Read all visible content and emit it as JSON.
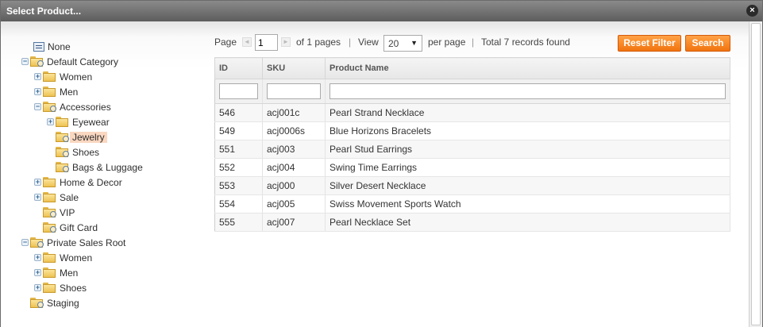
{
  "dialog": {
    "title": "Select Product...",
    "close_glyph": "×"
  },
  "tree": {
    "items": [
      {
        "label": "None",
        "icon": "none-icon"
      },
      {
        "label": "Default Category",
        "toggle": "−"
      },
      {
        "label": "Women",
        "toggle": "+"
      },
      {
        "label": "Men",
        "toggle": "+"
      },
      {
        "label": "Accessories",
        "toggle": "−"
      },
      {
        "label": "Eyewear",
        "toggle": "+"
      },
      {
        "label": "Jewelry",
        "selected": true
      },
      {
        "label": "Shoes"
      },
      {
        "label": "Bags & Luggage"
      },
      {
        "label": "Home & Decor",
        "toggle": "+"
      },
      {
        "label": "Sale",
        "toggle": "+"
      },
      {
        "label": "VIP"
      },
      {
        "label": "Gift Card"
      },
      {
        "label": "Private Sales Root",
        "toggle": "−"
      },
      {
        "label": "Women",
        "toggle": "+"
      },
      {
        "label": "Men",
        "toggle": "+"
      },
      {
        "label": "Shoes",
        "toggle": "+"
      },
      {
        "label": "Staging"
      }
    ]
  },
  "pager": {
    "page_label": "Page",
    "page_value": "1",
    "of_pages": "of 1 pages",
    "sep": "|",
    "view_label": "View",
    "per_page_value": "20",
    "per_page_label": "per page",
    "total": "Total 7 records found",
    "prev_glyph": "◄",
    "next_glyph": "►",
    "caret": "▼"
  },
  "buttons": {
    "reset": "Reset Filter",
    "search": "Search"
  },
  "grid": {
    "columns": [
      "ID",
      "SKU",
      "Product Name"
    ],
    "rows": [
      {
        "id": "546",
        "sku": "acj001c",
        "name": "Pearl Strand Necklace"
      },
      {
        "id": "549",
        "sku": "acj0006s",
        "name": "Blue Horizons Bracelets"
      },
      {
        "id": "551",
        "sku": "acj003",
        "name": "Pearl Stud Earrings"
      },
      {
        "id": "552",
        "sku": "acj004",
        "name": "Swing Time Earrings"
      },
      {
        "id": "553",
        "sku": "acj000",
        "name": "Silver Desert Necklace"
      },
      {
        "id": "554",
        "sku": "acj005",
        "name": "Swiss Movement Sports Watch"
      },
      {
        "id": "555",
        "sku": "acj007",
        "name": "Pearl Necklace Set"
      }
    ]
  },
  "colors": {
    "accent": "#f1740f",
    "selected_bg": "#fad7c0",
    "titlebar": "#5d5d5d"
  }
}
